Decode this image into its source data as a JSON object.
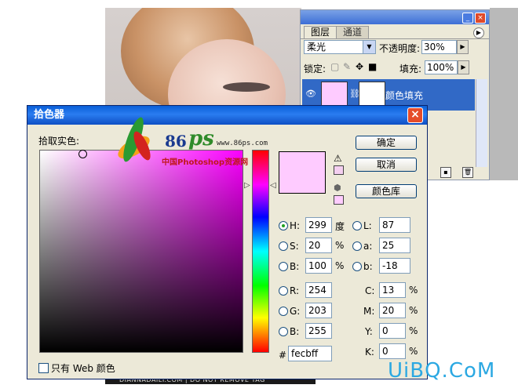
{
  "layers_panel": {
    "tabs": [
      "图层",
      "通道"
    ],
    "blend_mode": "柔光",
    "opacity_label": "不透明度:",
    "opacity_value": "30%",
    "lock_label": "锁定:",
    "fill_label": "填充:",
    "fill_value": "100%",
    "layer_name": "颜色填充"
  },
  "picker": {
    "title": "拾色器",
    "pick_label": "拾取实色:",
    "buttons": {
      "ok": "确定",
      "cancel": "取消",
      "library": "颜色库"
    },
    "hsb": {
      "h_label": "H:",
      "h_value": "299",
      "h_unit": "度",
      "s_label": "S:",
      "s_value": "20",
      "s_unit": "%",
      "b_label": "B:",
      "b_value": "100",
      "b_unit": "%"
    },
    "lab": {
      "l_label": "L:",
      "l_value": "87",
      "a_label": "a:",
      "a_value": "25",
      "b_label": "b:",
      "b_value": "-18"
    },
    "rgb": {
      "r_label": "R:",
      "r_value": "254",
      "g_label": "G:",
      "g_value": "203",
      "b_label": "B:",
      "b_value": "255"
    },
    "cmyk": {
      "c_label": "C:",
      "c_value": "13",
      "c_unit": "%",
      "m_label": "M:",
      "m_value": "20",
      "m_unit": "%",
      "y_label": "Y:",
      "y_value": "0",
      "y_unit": "%",
      "k_label": "K:",
      "k_value": "0",
      "k_unit": "%"
    },
    "hex_label": "#",
    "hex_value": "fecbff",
    "web_only_label": "只有 Web 颜色",
    "selected_color": "#fecbff"
  },
  "watermark": {
    "num": "86",
    "ps": "ps",
    "url": "www.86ps.com",
    "cn": "中国Photoshop资源网",
    "site": "UiBQ.CoM"
  },
  "photo_caption": "DIANNADAILY.COM | DO NOT REMOVE TAG"
}
